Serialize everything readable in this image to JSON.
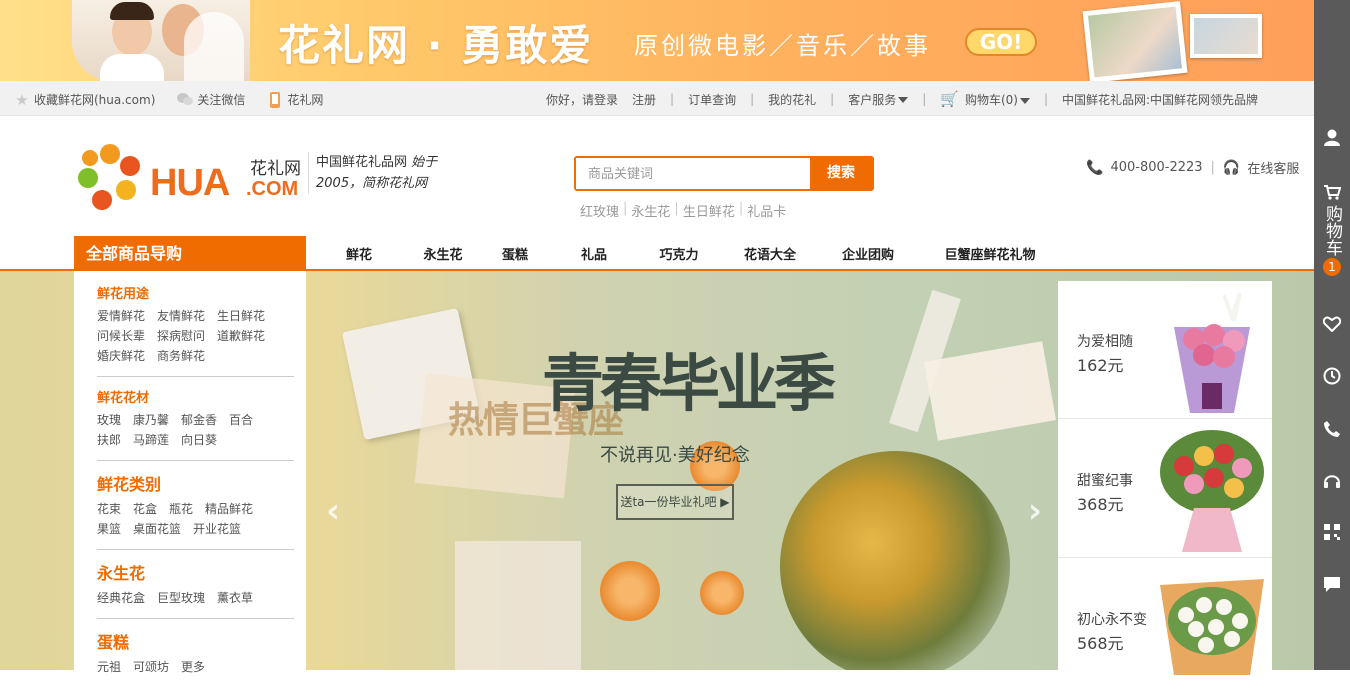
{
  "banner": {
    "title": "花礼网 · 勇敢爱",
    "subtitle": "原创微电影／音乐／故事",
    "go_label": "GO!"
  },
  "utility_bar": {
    "left_items": [
      {
        "label": "收藏鲜花网(hua.com)",
        "icon": "star-icon"
      },
      {
        "label": "关注微信",
        "icon": "wechat-icon"
      },
      {
        "label": "花礼网",
        "icon": "mobile-icon"
      }
    ],
    "greeting": "你好，请登录",
    "register": "注册",
    "order_query": "订单查询",
    "my_account": "我的花礼",
    "customer_service": "客户服务",
    "cart_label": "购物车(0)",
    "tagline": "中国鲜花礼品网:中国鲜花网领先品牌"
  },
  "header": {
    "logo_cn": "花礼网",
    "logo_hua": "HUA",
    "logo_com": ".COM",
    "slogan_line1": "中国鲜花礼品网",
    "slogan_since": "始于",
    "slogan_line2": "2005，简称花礼网",
    "search_placeholder": "商品关键词",
    "search_button": "搜索",
    "hot_words": [
      "红玫瑰",
      "永生花",
      "生日鲜花",
      "礼品卡"
    ],
    "hotline": "400-800-2223",
    "online_service": "在线客服"
  },
  "nav": {
    "all_categories": "全部商品导购",
    "items": [
      "鲜花",
      "永生花",
      "蛋糕",
      "礼品",
      "巧克力",
      "花语大全",
      "企业团购",
      "巨蟹座鲜花礼物"
    ]
  },
  "category_menu": [
    {
      "title": "鲜花用途",
      "size": "small",
      "links": [
        "爱情鲜花",
        "友情鲜花",
        "生日鲜花",
        "问候长辈",
        "探病慰问",
        "道歉鲜花",
        "婚庆鲜花",
        "商务鲜花"
      ]
    },
    {
      "title": "鲜花花材",
      "size": "small",
      "links": [
        "玫瑰",
        "康乃馨",
        "郁金香",
        "百合",
        "扶郎",
        "马蹄莲",
        "向日葵"
      ]
    },
    {
      "title": "鲜花类别",
      "size": "big",
      "links": [
        "花束",
        "花盒",
        "瓶花",
        "精品鲜花",
        "果篮",
        "桌面花篮",
        "开业花篮"
      ]
    },
    {
      "title": "永生花",
      "size": "big",
      "links": [
        "经典花盒",
        "巨型玫瑰",
        "薰衣草"
      ]
    },
    {
      "title": "蛋糕",
      "size": "big",
      "links": [
        "元祖",
        "可颂坊",
        "更多"
      ]
    }
  ],
  "hero": {
    "title": "青春毕业季",
    "ghost_text": "热情巨蟹座",
    "subtitle": "不说再见·美好纪念",
    "cta": "送ta一份毕业礼吧 ▶"
  },
  "promo_cards": [
    {
      "name": "为爱相随",
      "price": "162元",
      "flower_color": "#e87aa0",
      "wrap_color": "#b99ad6"
    },
    {
      "name": "甜蜜纪事",
      "price": "368元",
      "flower_color": "#d73a3a",
      "wrap_color": "#f0b8c8"
    },
    {
      "name": "初心永不变",
      "price": "568元",
      "flower_color": "#f4f1e6",
      "wrap_color": "#e9a860"
    }
  ],
  "toolbar": {
    "cart_label": "购物车",
    "cart_count": "1"
  },
  "colors": {
    "brand": "#f06c00",
    "toolbar": "#5a5a5a"
  }
}
